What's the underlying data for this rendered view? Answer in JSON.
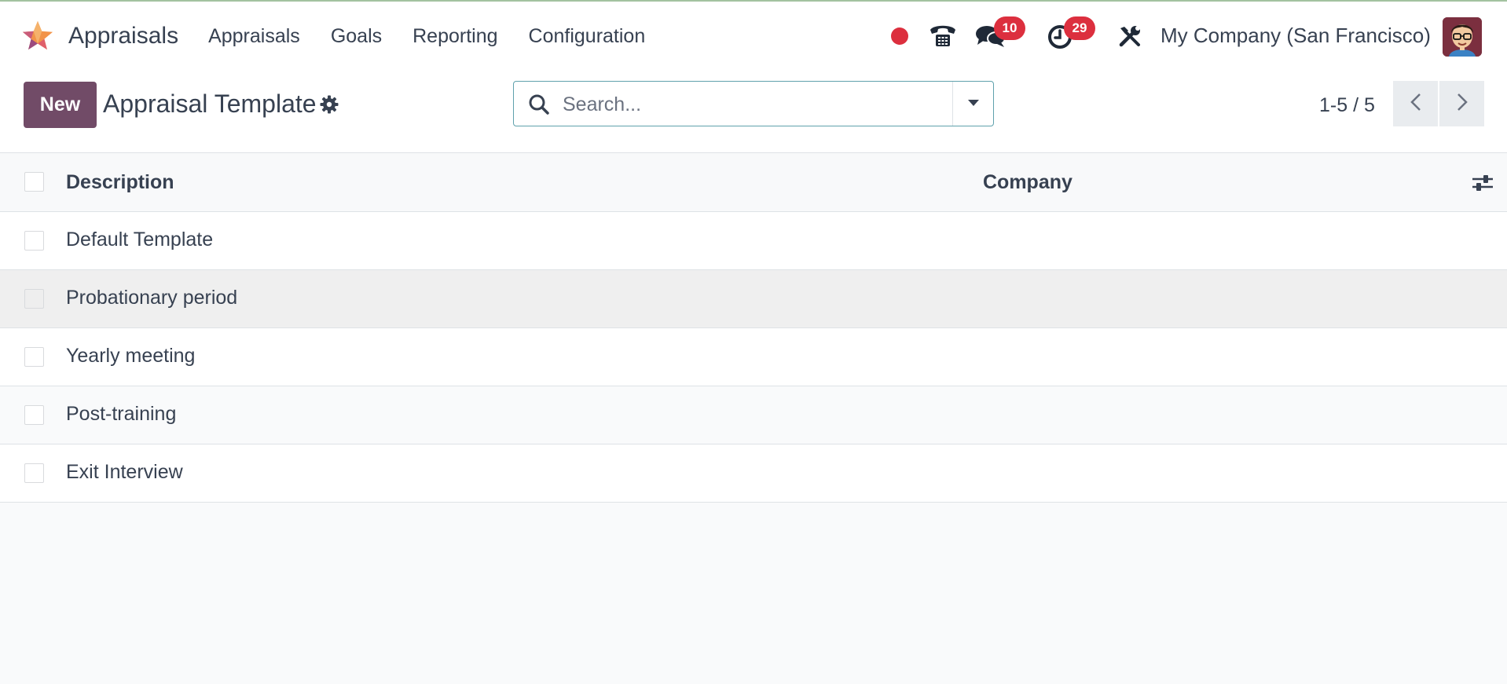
{
  "navbar": {
    "app_name": "Appraisals",
    "menu": [
      "Appraisals",
      "Goals",
      "Reporting",
      "Configuration"
    ],
    "messages_count": "10",
    "activities_count": "29",
    "company": "My Company (San Francisco)"
  },
  "control": {
    "new_label": "New",
    "title": "Appraisal Template",
    "search_placeholder": "Search...",
    "pager": "1-5 / 5"
  },
  "list": {
    "columns": {
      "description": "Description",
      "company": "Company"
    },
    "rows": [
      {
        "description": "Default Template",
        "company": ""
      },
      {
        "description": "Probationary period",
        "company": ""
      },
      {
        "description": "Yearly meeting",
        "company": ""
      },
      {
        "description": "Post-training",
        "company": ""
      },
      {
        "description": "Exit Interview",
        "company": ""
      }
    ]
  },
  "colors": {
    "brand": "#714b67",
    "badge": "#dc2f3e",
    "search_border": "#5fa1ac"
  }
}
